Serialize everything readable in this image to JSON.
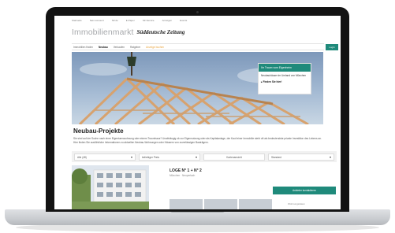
{
  "topnav": {
    "items": [
      "Startseite",
      "Netz-Account",
      "SZ.de",
      "E-Paper",
      "SZ-Service",
      "Anzeigen",
      "Events"
    ]
  },
  "brand": {
    "name": "Immobilienmarkt",
    "publisher": "Süddeutsche Zeitung"
  },
  "mainnav": {
    "items": [
      "Immobilien finden",
      "Neubau",
      "Verkaufen",
      "Ratgeber"
    ],
    "active": "Neubau",
    "accent_item": "Anzeige buchen",
    "login_label": "Login"
  },
  "promo": {
    "title": "Ihr Traum vom Eigenheim",
    "text": "Neubauhäuser im Umland von München",
    "link": "Finden Sie hier!"
  },
  "page": {
    "title": "Neubau-Projekte",
    "intro": "Sie sind auf der Suche nach einer Eigentumswohnung oder einem Traumhaus? Unabhängig ob zur Eigennutzung oder als Kapitalanlage, der Kauf einer Immobilie steht oft als bedeutendste private Investition des Lebens an. Hier finden Sie ausführliche Informationen zu aktuellen Neubau-Wohnungen oder Häusern von zuverlässigen Bauträgern."
  },
  "filters": {
    "location": "Alle (48)",
    "price": "beliebiger Preis",
    "map": "Kartenansicht",
    "sort": "Standard"
  },
  "listing": {
    "title": "LOGE N° 1 + N° 2",
    "location": "München · Neuperlach",
    "contact_button": "Anbieter kontaktieren",
    "side_label": "Wohnungsdaten"
  },
  "colors": {
    "accent": "#1f8a7b",
    "highlight": "#e8a33c"
  }
}
